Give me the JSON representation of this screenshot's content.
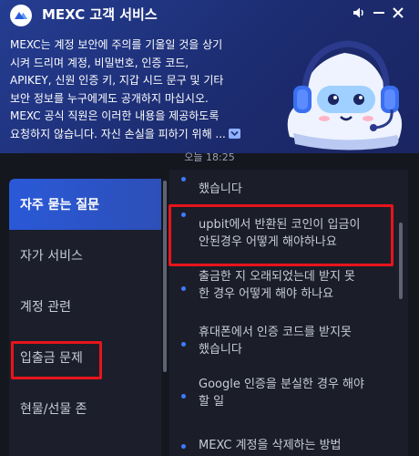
{
  "app": {
    "title": "MEXC 고객 서비스",
    "brand_color": "#2a59d8"
  },
  "window_controls": [
    {
      "name": "sound",
      "icon": "speaker-icon"
    },
    {
      "name": "minimize",
      "icon": "minimize-icon"
    },
    {
      "name": "close",
      "icon": "close-icon"
    }
  ],
  "notice": {
    "lines": [
      "MEXC는 계정 보안에 주의를 기울일 것을 상기",
      "시켜 드리며 계정, 비밀번호, 인증 코드,",
      "APIKEY, 신원 인증 키, 지갑 시드 문구 및 기타",
      "보안 정보를 누구에게도 공개하지 마십시오.",
      "MEXC 공식 직원은 이러한 내용을 제공하도록",
      "요청하지 않습니다. 자신 손실을 피하기 위해 ..."
    ],
    "more_icon": "expand-more-icon"
  },
  "chat": {
    "timestamp": "오늘 18:25"
  },
  "sidebar": {
    "items": [
      {
        "label": "자주 묻는 질문",
        "active": true
      },
      {
        "label": "자가 서비스",
        "active": false
      },
      {
        "label": "계정 관련",
        "active": false
      },
      {
        "label": "입출금 문제",
        "active": false,
        "highlighted": true
      },
      {
        "label": "현물/선물 존",
        "active": false
      }
    ]
  },
  "faq": {
    "items": [
      {
        "lines": [
          "했습니다"
        ]
      },
      {
        "lines": [
          "upbit에서 반환된 코인이 입금이",
          "안된경우 어떻게 해야하나요"
        ],
        "highlighted": true
      },
      {
        "lines": [
          "출금한 지 오래되었는데 받지 못",
          "한 경우 어떻게 해야 하나요"
        ]
      },
      {
        "lines": [
          "휴대폰에서 인증 코드를 받지못",
          "했습니다"
        ]
      },
      {
        "lines": [
          "Google 인증을 분실한 경우 해야",
          "할 일"
        ]
      },
      {
        "lines": [
          "MEXC 계정을 삭제하는 방법"
        ]
      }
    ]
  },
  "highlight_color": "#e8141b"
}
